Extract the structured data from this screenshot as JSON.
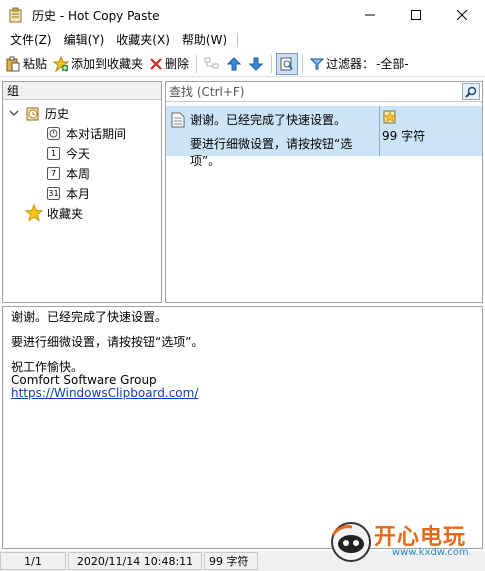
{
  "window": {
    "title": "历史 - Hot Copy Paste"
  },
  "menu": {
    "file": "文件(Z)",
    "edit": "编辑(Y)",
    "favorites": "收藏夹(X)",
    "help": "帮助(W)"
  },
  "toolbar": {
    "paste": "粘贴",
    "add_to_favorites": "添加到收藏夹",
    "delete": "删除",
    "filter_label": "过滤器：",
    "filter_value": "-全部-"
  },
  "groups": {
    "header": "组",
    "history": "历史",
    "this_session": "本对话期间",
    "today": "今天",
    "this_week": "本周",
    "this_month": "本月",
    "favorites": "收藏夹",
    "cal_today": "1",
    "cal_week": "7",
    "cal_month": "31"
  },
  "search": {
    "placeholder": "查找 (Ctrl+F)"
  },
  "clips": [
    {
      "line1": "谢谢。已经完成了快速设置。",
      "line2": "要进行细微设置，请按按钮“选项”。",
      "size": "99 字符"
    }
  ],
  "preview": {
    "line1": "谢谢。已经完成了快速设置。",
    "line2": "要进行细微设置，请按按钮“选项”。",
    "line3": "祝工作愉快。",
    "line4": "Comfort Software Group",
    "link": "https://WindowsClipboard.com/"
  },
  "status": {
    "position": "1/1",
    "datetime": "2020/11/14 10:48:11",
    "size": "99 字符"
  },
  "watermark": {
    "title": "开心电玩",
    "url": "www.kxdw.com"
  }
}
